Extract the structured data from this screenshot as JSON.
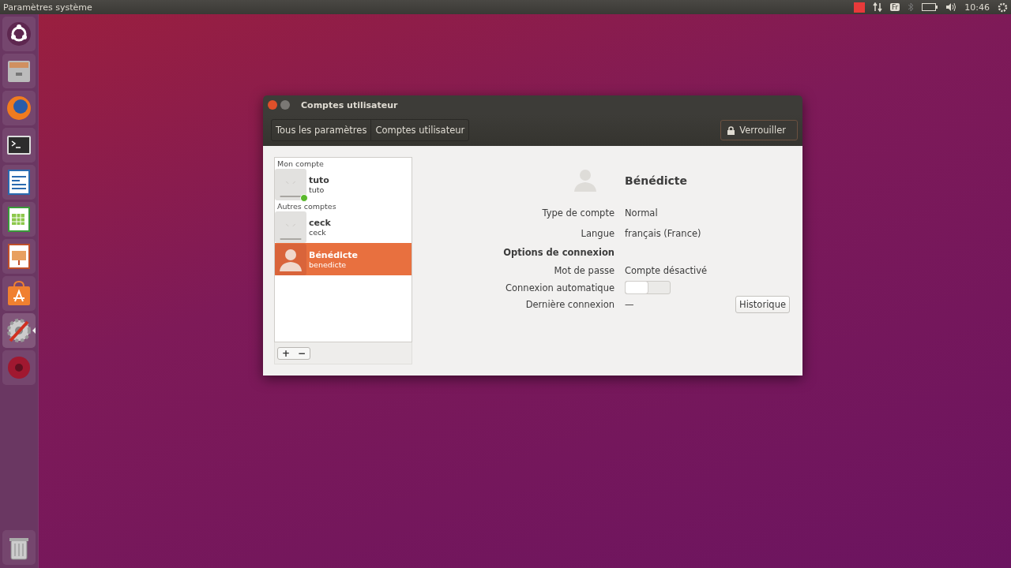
{
  "top_bar": {
    "app_title": "Paramètres système",
    "keyboard_layout": "Fr",
    "clock": "10:46"
  },
  "launcher": {
    "items": [
      {
        "kind": "dash",
        "running": false
      },
      {
        "kind": "files",
        "running": false
      },
      {
        "kind": "browser",
        "running": false
      },
      {
        "kind": "terminal",
        "running": false
      },
      {
        "kind": "writer",
        "running": false
      },
      {
        "kind": "calc",
        "running": false
      },
      {
        "kind": "impress",
        "running": false
      },
      {
        "kind": "store",
        "running": false
      },
      {
        "kind": "settings",
        "running": true
      },
      {
        "kind": "disc",
        "running": false
      },
      {
        "kind": "trash",
        "running": false
      }
    ]
  },
  "window": {
    "title": "Comptes utilisateur",
    "breadcrumbs": [
      "Tous les paramètres",
      "Comptes utilisateur"
    ],
    "lock_button": "Verrouiller",
    "user_groups": [
      {
        "heading": "Mon compte",
        "users": [
          {
            "name": "tuto",
            "login": "tuto",
            "online": true,
            "selected": false,
            "kind": "blank"
          }
        ]
      },
      {
        "heading": "Autres comptes",
        "users": [
          {
            "name": "ceck",
            "login": "ceck",
            "online": false,
            "selected": false,
            "kind": "blank"
          },
          {
            "name": "Bénédicte",
            "login": "benedicte",
            "online": false,
            "selected": true,
            "kind": "silhouette"
          }
        ]
      }
    ],
    "list_buttons": [
      "+",
      "−"
    ],
    "details": {
      "name": "Bénédicte",
      "rows": [
        {
          "kind": "text",
          "label": "Type de compte",
          "value": "Normal"
        },
        {
          "kind": "text",
          "label": "Langue",
          "value": "français (France)"
        },
        {
          "kind": "heading",
          "label": "Options de connexion"
        },
        {
          "kind": "text",
          "label": "Mot de passe",
          "value": "Compte désactivé"
        },
        {
          "kind": "switch",
          "label": "Connexion automatique",
          "on": false
        },
        {
          "kind": "history",
          "label": "Dernière connexion",
          "value": "—",
          "button": "Historique"
        }
      ]
    }
  }
}
